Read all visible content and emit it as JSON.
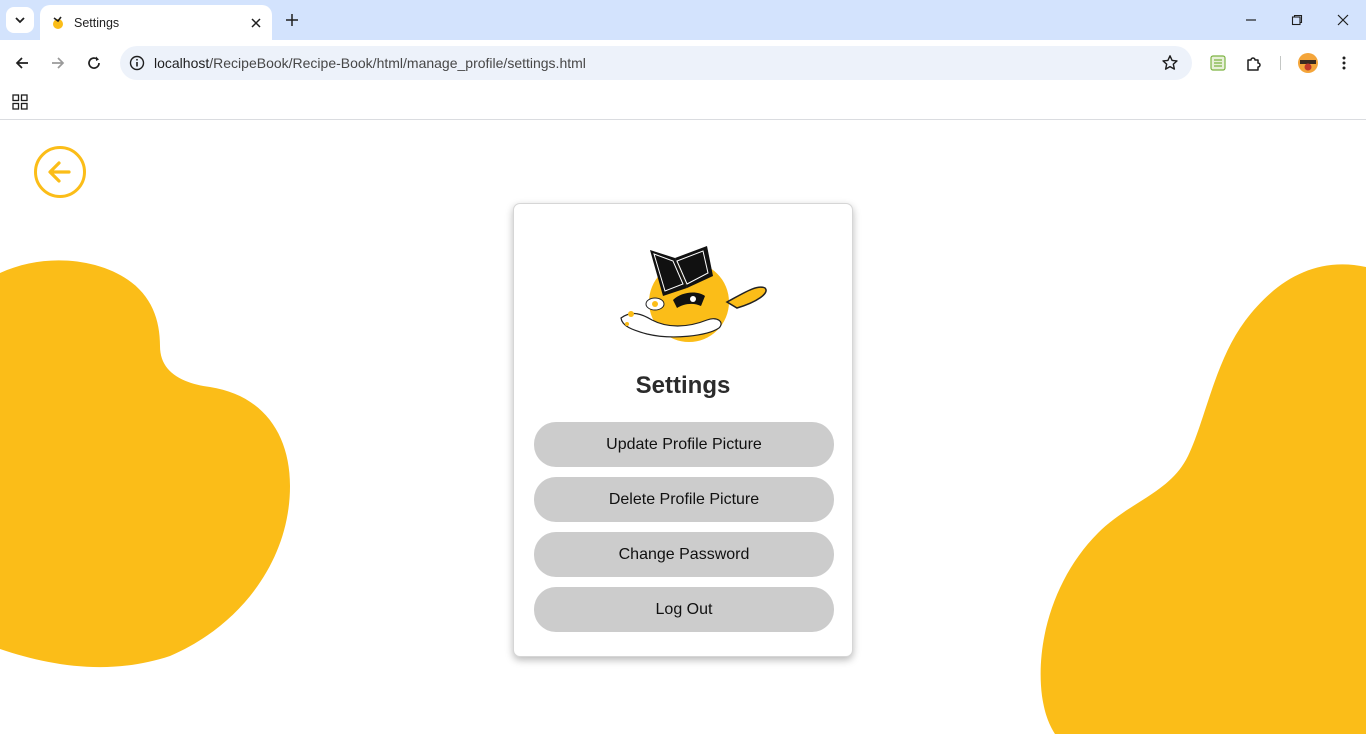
{
  "browser": {
    "tab_title": "Settings",
    "url_host": "localhost",
    "url_path": "/RecipeBook/Recipe-Book/html/manage_profile/settings.html"
  },
  "page": {
    "title": "Settings",
    "buttons": {
      "update_picture": "Update Profile Picture",
      "delete_picture": "Delete Profile Picture",
      "change_password": "Change Password",
      "log_out": "Log Out"
    }
  },
  "colors": {
    "accent": "#fbbd18",
    "button_bg": "#cccccc",
    "tabbar_bg": "#d3e3fd",
    "omnibox_bg": "#edf2fa"
  },
  "icons": {
    "back": "arrow-left-circle-icon",
    "logo": "recipe-book-logo"
  }
}
